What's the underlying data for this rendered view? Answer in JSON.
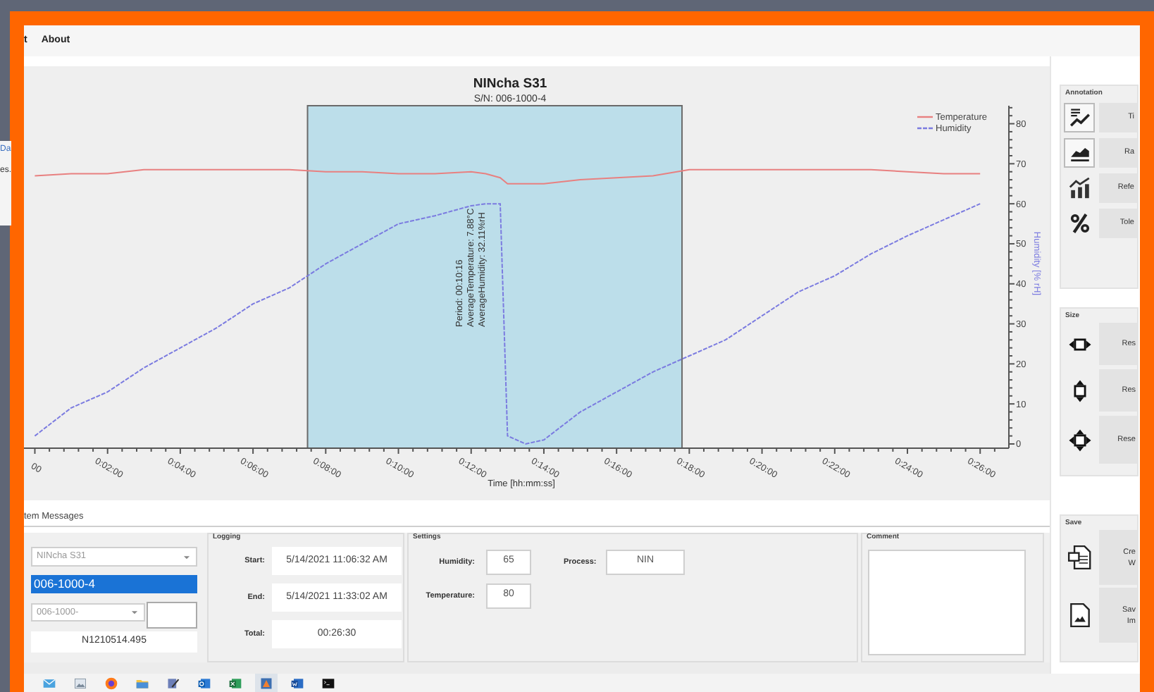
{
  "background_window": {
    "texts": [
      "Da",
      "es."
    ]
  },
  "menu": [
    {
      "label": "t"
    },
    {
      "label": "About"
    }
  ],
  "chart": {
    "title": "NINcha S31",
    "subtitle": "S/N: 006-1000-4",
    "chart_data": {
      "type": "line",
      "xlabel": "Time [hh:mm:ss]",
      "ylabel": "Humidity [% rH]",
      "x": [
        0,
        1,
        2,
        3,
        4,
        5,
        6,
        7,
        8,
        9,
        10,
        11,
        12,
        12.4,
        12.8,
        13,
        13.5,
        14,
        15,
        16,
        17,
        18,
        19,
        20,
        21,
        22,
        23,
        24,
        25,
        26
      ],
      "series": [
        {
          "name": "Temperature",
          "color": "#e88080",
          "line_style": "solid",
          "values": [
            67,
            67.5,
            67.5,
            68.5,
            68.5,
            68.5,
            68.5,
            68.5,
            68,
            68,
            67.5,
            67.5,
            68,
            67.5,
            66.5,
            65,
            65,
            65,
            66,
            66.5,
            67,
            68.5,
            68.5,
            68.5,
            68.5,
            68.5,
            68.5,
            68,
            67.5,
            67.5
          ]
        },
        {
          "name": "Humidity",
          "color": "#7b7be0",
          "line_style": "dashed",
          "values": [
            2,
            9,
            13,
            19,
            24,
            29,
            35,
            39,
            45,
            50,
            55,
            57,
            59.5,
            60,
            60,
            2,
            0,
            1,
            8,
            13,
            18,
            22,
            26,
            32,
            38,
            42,
            47.5,
            52,
            56,
            60
          ]
        }
      ],
      "xlim": [
        -0.3,
        26.79
      ],
      "ylim": [
        -1.06,
        84.5
      ],
      "legend": "upper right",
      "xticks": [
        {
          "value": 0,
          "label": "00"
        },
        {
          "value": 2,
          "label": "0:02:00"
        },
        {
          "value": 4,
          "label": "0:04:00"
        },
        {
          "value": 6,
          "label": "0:06:00"
        },
        {
          "value": 8,
          "label": "0:08:00"
        },
        {
          "value": 10,
          "label": "0:10:00"
        },
        {
          "value": 12,
          "label": "0:12:00"
        },
        {
          "value": 14,
          "label": "0:14:00"
        },
        {
          "value": 16,
          "label": "0:16:00"
        },
        {
          "value": 18,
          "label": "0:18:00"
        },
        {
          "value": 20,
          "label": "0:20:00"
        },
        {
          "value": 22,
          "label": "0:22:00"
        },
        {
          "value": 24,
          "label": "0:24:00"
        },
        {
          "value": 26,
          "label": "0:26:00"
        }
      ],
      "yticks": [
        0,
        10,
        20,
        30,
        40,
        50,
        60,
        70,
        80
      ],
      "bands": [
        {
          "axis": "x",
          "from": 7.5,
          "to": 17.8
        }
      ],
      "annotations": [
        "Period: 00:10:16",
        "AverageTemperature: 7.88°C",
        "AverageHumidity: 32.11%rH"
      ]
    }
  },
  "messages_tab": "tem Messages",
  "device": {
    "model": "NINcha S31",
    "serial": "006-1000-4",
    "serial_prefix": "006-1000-",
    "file": "N1210514.495"
  },
  "logging": {
    "title": "Logging",
    "rows": [
      {
        "label": "Start:",
        "value": "5/14/2021 11:06:32 AM"
      },
      {
        "label": "End:",
        "value": "5/14/2021 11:33:02 AM"
      },
      {
        "label": "Total:",
        "value": "00:26:30"
      }
    ]
  },
  "settings": {
    "title": "Settings",
    "fields": [
      {
        "label": "Humidity:",
        "value": "65"
      },
      {
        "label": "Temperature:",
        "value": "80"
      },
      {
        "label": "Process:",
        "value": "NIN"
      }
    ]
  },
  "comment": {
    "title": "Comment"
  },
  "annotation_panel": {
    "title": "Annotation",
    "items": [
      {
        "kind": "title",
        "label": "Ti",
        "active": true
      },
      {
        "kind": "range",
        "label": "Ra",
        "active": true
      },
      {
        "kind": "reference",
        "label": "Refe",
        "active": false
      },
      {
        "kind": "tolerance",
        "label": "Tole",
        "active": false
      }
    ]
  },
  "size_panel": {
    "title": "Size",
    "items": [
      {
        "kind": "horizontal",
        "label": "Res"
      },
      {
        "kind": "vertical",
        "label": "Res"
      },
      {
        "kind": "both",
        "label": "Rese"
      }
    ]
  },
  "save_panel": {
    "title": "Save",
    "items": [
      {
        "kind": "word",
        "label": "Cre\nW"
      },
      {
        "kind": "image",
        "label": "Sav\nIm"
      }
    ]
  },
  "taskbar": [
    {
      "kind": "mail",
      "selected": false
    },
    {
      "kind": "photos",
      "selected": false
    },
    {
      "kind": "browser",
      "selected": false
    },
    {
      "kind": "folder",
      "selected": false
    },
    {
      "kind": "paint",
      "selected": false
    },
    {
      "kind": "outlook",
      "selected": false
    },
    {
      "kind": "excel",
      "selected": false
    },
    {
      "kind": "app",
      "selected": true
    },
    {
      "kind": "word",
      "selected": false
    },
    {
      "kind": "terminal",
      "selected": false
    }
  ]
}
